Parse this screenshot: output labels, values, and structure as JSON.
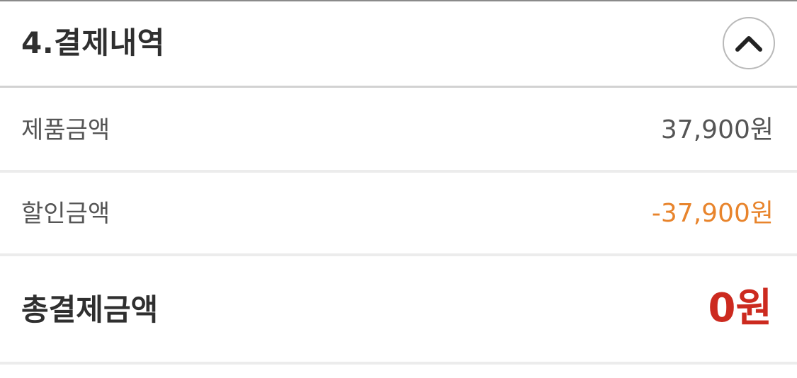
{
  "section": {
    "title": "4.결제내역",
    "collapse_icon": "chevron-up-icon"
  },
  "rows": {
    "product_amount": {
      "label": "제품금액",
      "value": "37,900원"
    },
    "discount_amount": {
      "label": "할인금액",
      "value": "-37,900원"
    }
  },
  "total": {
    "label": "총결제금액",
    "value": "0원"
  },
  "colors": {
    "discount": "#e8842c",
    "total": "#cc2a1f",
    "text_dark": "#2f2f2f",
    "text_mid": "#555555"
  }
}
